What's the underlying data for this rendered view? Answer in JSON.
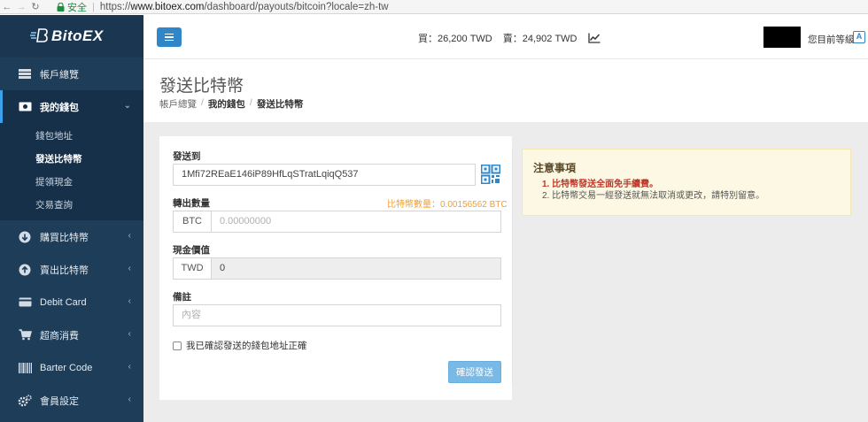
{
  "browser": {
    "secure_label": "安全",
    "url_scheme": "https://",
    "url_host": "www.bitoex.com",
    "url_path": "/dashboard/payouts/bitcoin?locale=zh-tw"
  },
  "brand": {
    "name": "BitoEX"
  },
  "sidebar": {
    "items": [
      {
        "label": "帳戶總覽",
        "icon": "dashboard-icon"
      },
      {
        "label": "我的錢包",
        "icon": "wallet-icon",
        "active": true
      },
      {
        "label": "購買比特幣",
        "icon": "arrow-down-circle-icon"
      },
      {
        "label": "賣出比特幣",
        "icon": "arrow-up-circle-icon"
      },
      {
        "label": "Debit Card",
        "icon": "credit-card-icon"
      },
      {
        "label": "超商消費",
        "icon": "cart-icon"
      },
      {
        "label": "Barter Code",
        "icon": "barcode-icon"
      },
      {
        "label": "會員設定",
        "icon": "gears-icon"
      }
    ],
    "submenu": [
      {
        "label": "錢包地址"
      },
      {
        "label": "發送比特幣",
        "current": true
      },
      {
        "label": "提領現金"
      },
      {
        "label": "交易查詢"
      }
    ]
  },
  "topbar": {
    "buy_price": "買：26,200 TWD",
    "sell_price": "賣：24,902 TWD",
    "user_level_label": "您目前等級"
  },
  "page": {
    "title": "發送比特幣",
    "breadcrumb": [
      "帳戶總覽",
      "我的錢包",
      "發送比特幣"
    ]
  },
  "form": {
    "send_to_label": "發送到",
    "address_value": "1Mfi72REaE146iP89HfLqSTratLqiqQ537",
    "amount_label": "轉出數量",
    "balance_text": "比特幣數量：0.00156562 BTC",
    "amount_unit": "BTC",
    "amount_placeholder": "0.00000000",
    "cash_label": "現金價值",
    "cash_unit": "TWD",
    "cash_value": "0",
    "note_label": "備註",
    "note_placeholder": "內容",
    "confirm_checkbox_label": "我已確認發送的錢包地址正確",
    "submit_label": "確認發送"
  },
  "notice": {
    "title": "注意事項",
    "items": [
      "1. 比特幣發送全面免手續費。",
      "2. 比特幣交易一經發送就無法取消或更改，請特別留意。"
    ]
  },
  "colors": {
    "sidebar_bg": "#1e3d59",
    "primary": "#2f87c8",
    "balance": "#f0a030",
    "notice_bg": "#fcf8e3",
    "notice_highlight": "#c0392b"
  }
}
